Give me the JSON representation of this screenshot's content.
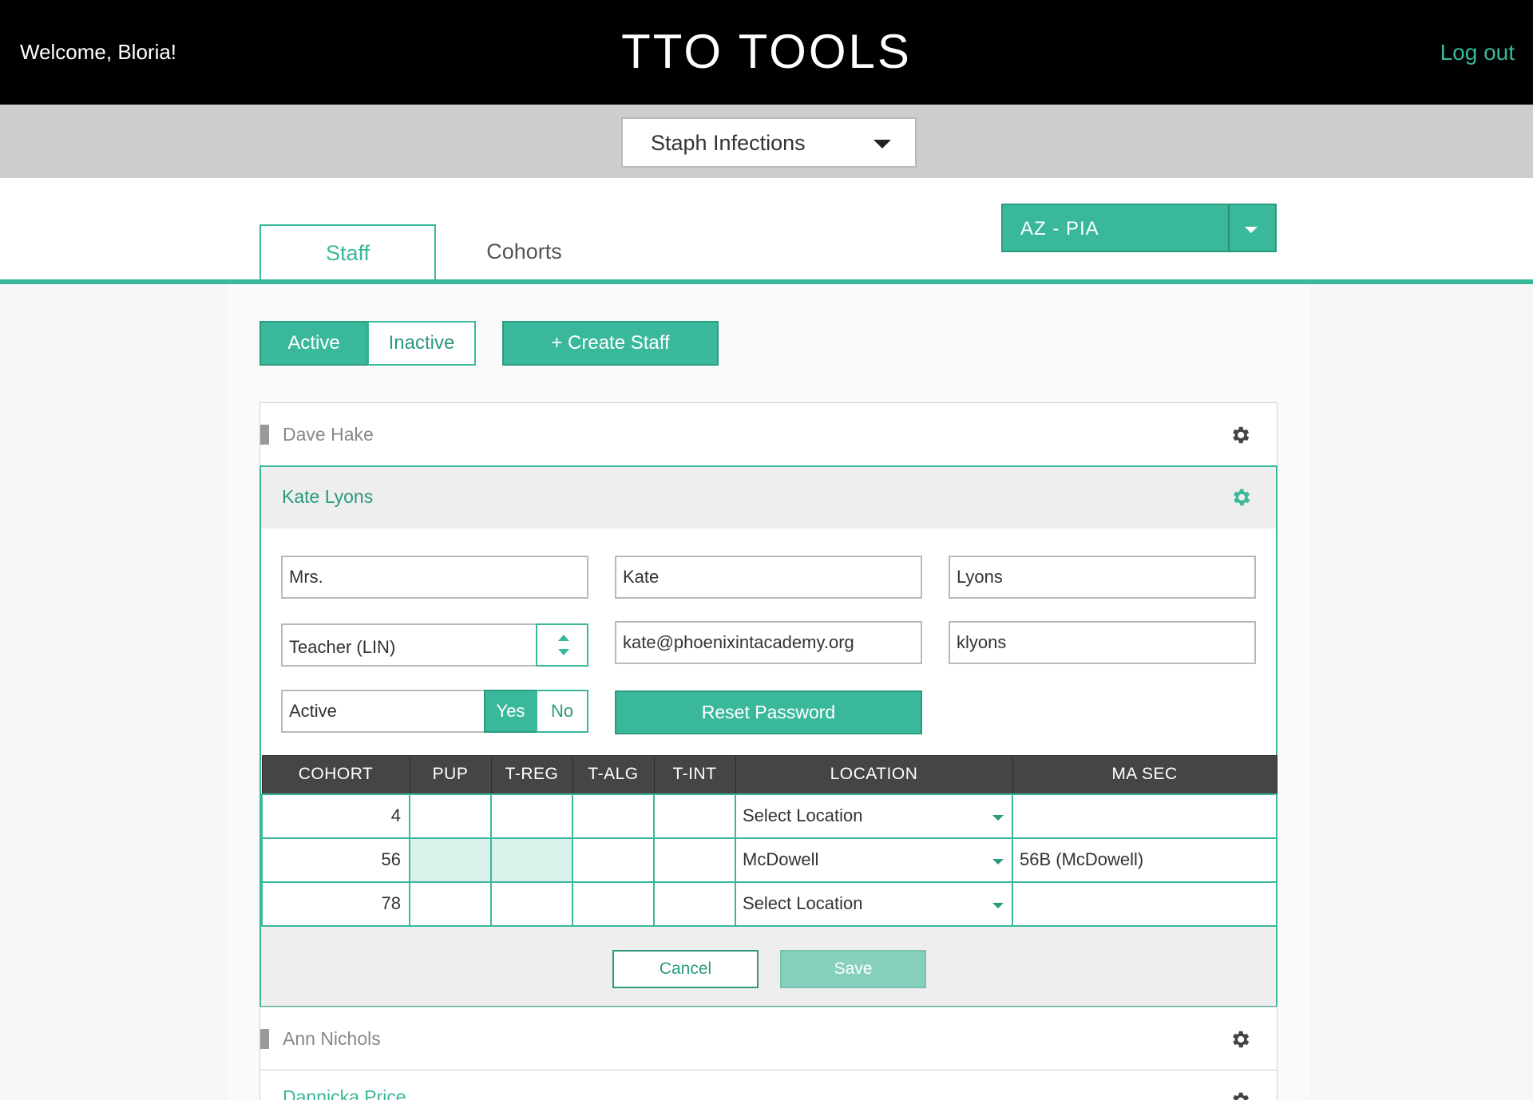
{
  "header": {
    "welcome": "Welcome, Bloria!",
    "title": "TTO TOOLS",
    "logout": "Log out"
  },
  "program_select": {
    "value": "Staph Infections"
  },
  "tabs": [
    {
      "label": "Staff",
      "active": true
    },
    {
      "label": "Cohorts",
      "active": false
    }
  ],
  "region_select": {
    "value": "AZ - PIA"
  },
  "filters": {
    "active": "Active",
    "inactive": "Inactive"
  },
  "create_staff": "+ Create Staff",
  "staff": [
    {
      "name": "Dave Hake"
    },
    {
      "name": "Kate Lyons"
    },
    {
      "name": "Ann Nichols"
    },
    {
      "name": "Dannicka Price"
    }
  ],
  "form": {
    "prefix": "Mrs.",
    "first_name": "Kate",
    "last_name": "Lyons",
    "role": "Teacher (LIN)",
    "email": "kate@phoenixintacademy.org",
    "username": "klyons",
    "active_label": "Active",
    "yes": "Yes",
    "no": "No",
    "reset_password": "Reset Password"
  },
  "cohort_table": {
    "headers": [
      "COHORT",
      "PUP",
      "T-REG",
      "T-ALG",
      "T-INT",
      "LOCATION",
      "MA SEC"
    ],
    "rows": [
      {
        "cohort": "4",
        "location": "Select Location",
        "ma_sec": ""
      },
      {
        "cohort": "56",
        "location": "McDowell",
        "ma_sec": "56B (McDowell)"
      },
      {
        "cohort": "78",
        "location": "Select Location",
        "ma_sec": ""
      }
    ]
  },
  "actions": {
    "cancel": "Cancel",
    "save": "Save"
  },
  "colors": {
    "accent": "#3ab89b",
    "accent_dark": "#2a9a80",
    "header_bg": "#000000"
  }
}
